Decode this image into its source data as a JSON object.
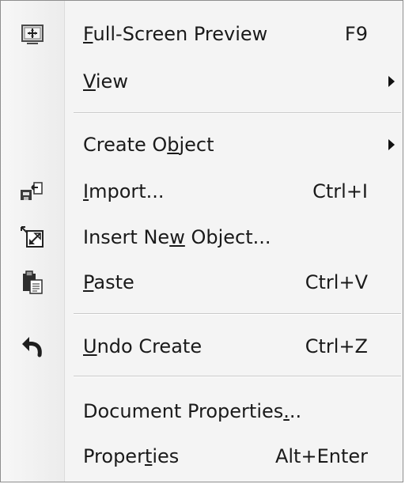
{
  "menu": {
    "items": [
      {
        "key": "fullscreen",
        "pre": "",
        "u": "F",
        "post": "ull-Screen Preview",
        "shortcut": "F9",
        "icon": "fullscreen-preview-icon",
        "submenu": false
      },
      {
        "key": "view",
        "pre": "",
        "u": "V",
        "post": "iew",
        "shortcut": "",
        "icon": "",
        "submenu": true
      },
      {
        "key": "create-object",
        "pre": "Create O",
        "u": "b",
        "post": "ject",
        "shortcut": "",
        "icon": "",
        "submenu": true
      },
      {
        "key": "import",
        "pre": "",
        "u": "I",
        "post": "mport...",
        "shortcut": "Ctrl+I",
        "icon": "import-icon",
        "submenu": false
      },
      {
        "key": "insert-new-object",
        "pre": "Insert Ne",
        "u": "w",
        "post": " Object...",
        "shortcut": "",
        "icon": "insert-object-icon",
        "submenu": false
      },
      {
        "key": "paste",
        "pre": "",
        "u": "P",
        "post": "aste",
        "shortcut": "Ctrl+V",
        "icon": "paste-icon",
        "submenu": false
      },
      {
        "key": "undo-create",
        "pre": "",
        "u": "U",
        "post": "ndo Create",
        "shortcut": "Ctrl+Z",
        "icon": "undo-icon",
        "submenu": false
      },
      {
        "key": "document-properties",
        "pre": "Document Properties",
        "u": ".",
        "post": "..",
        "shortcut": "",
        "icon": "",
        "submenu": false
      },
      {
        "key": "properties",
        "pre": "Proper",
        "u": "t",
        "post": "ies",
        "shortcut": "Alt+Enter",
        "icon": "",
        "submenu": false
      }
    ]
  },
  "colors": {
    "menu_bg": "#f4f4f4",
    "border": "#8e8e8e",
    "text": "#1a1a1a",
    "separator": "#c9c9c9"
  }
}
